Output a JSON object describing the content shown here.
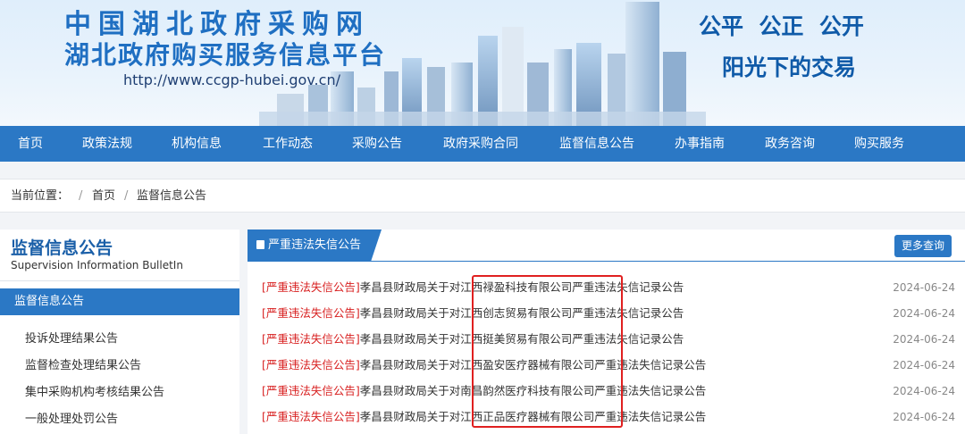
{
  "header": {
    "title_line1": "中国湖北政府采购网",
    "title_line2": "湖北政府购买服务信息平台",
    "url": "http://www.ccgp-hubei.gov.cn/",
    "slogan_line1": "公平  公正  公开",
    "slogan_line2": "阳光下的交易"
  },
  "nav": {
    "items": [
      "首页",
      "政策法规",
      "机构信息",
      "工作动态",
      "采购公告",
      "政府采购合同",
      "监督信息公告",
      "办事指南",
      "政务咨询",
      "购买服务"
    ]
  },
  "breadcrumb": {
    "label": "当前位置：",
    "separator": "/",
    "items": [
      "首页",
      "监督信息公告"
    ]
  },
  "sidebar": {
    "title": "监督信息公告",
    "subtitle": "Supervision Information BulletIn",
    "active_item": "监督信息公告",
    "items": [
      "投诉处理结果公告",
      "监督检查处理结果公告",
      "集中采购机构考核结果公告",
      "一般处理处罚公告"
    ]
  },
  "main": {
    "tab_label": "严重违法失信公告",
    "more_button": "更多查询",
    "rows": [
      {
        "tag": "[严重违法失信公告]",
        "title": "孝昌县财政局关于对江西禄盈科技有限公司严重违法失信记录公告",
        "date": "2024-06-24"
      },
      {
        "tag": "[严重违法失信公告]",
        "title": "孝昌县财政局关于对江西创志贸易有限公司严重违法失信记录公告",
        "date": "2024-06-24"
      },
      {
        "tag": "[严重违法失信公告]",
        "title": "孝昌县财政局关于对江西挺美贸易有限公司严重违法失信记录公告",
        "date": "2024-06-24"
      },
      {
        "tag": "[严重违法失信公告]",
        "title": "孝昌县财政局关于对江西盈安医疗器械有限公司严重违法失信记录公告",
        "date": "2024-06-24"
      },
      {
        "tag": "[严重违法失信公告]",
        "title": "孝昌县财政局关于对南昌韵然医疗科技有限公司严重违法失信记录公告",
        "date": "2024-06-24"
      },
      {
        "tag": "[严重违法失信公告]",
        "title": "孝昌县财政局关于对江西正品医疗器械有限公司严重违法失信记录公告",
        "date": "2024-06-24"
      }
    ]
  },
  "colors": {
    "brand_blue": "#2b78c5",
    "tag_red": "#d82121",
    "highlight_red": "#e02020"
  }
}
